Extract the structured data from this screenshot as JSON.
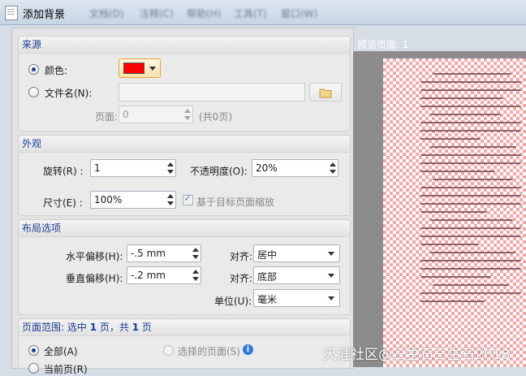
{
  "window": {
    "title": "添加背景",
    "bg_menus": [
      "文档(D)",
      "注释(C)",
      "帮助(H)",
      "工具(T)",
      "窗口(W)"
    ]
  },
  "source": {
    "header": "来源",
    "color_label": "颜色:",
    "color_value": "#ff0000",
    "file_label": "文件名(N):",
    "file_value": "",
    "page_label": "页面:",
    "page_value": "0",
    "page_total": "(共0页)"
  },
  "appearance": {
    "header": "外观",
    "rotation_label": "旋转(R) :",
    "rotation_value": "1",
    "opacity_label": "不透明度(O):",
    "opacity_value": "20%",
    "size_label": "尺寸(E) :",
    "size_value": "100%",
    "scale_label": "基于目标页面缩放"
  },
  "layout": {
    "header": "布局选项",
    "h_offset_label": "水平偏移(H):",
    "h_offset_value": "-.5 mm",
    "v_offset_label": "垂直偏移(H):",
    "v_offset_value": "-.2 mm",
    "align1_label": "对齐:",
    "align1_value": "居中",
    "align2_label": "对齐:",
    "align2_value": "底部",
    "unit_label": "单位(U):",
    "unit_value": "毫米"
  },
  "page_range": {
    "header_prefix": "页面范围: 选中",
    "selected": "1",
    "mid": "页，共",
    "total": "1",
    "suffix": "页",
    "all_label": "全部(A)",
    "selected_pages_label": "选择的页面(S)",
    "info_glyph": "i",
    "partial_label": "当前页(R)"
  },
  "preview": {
    "label": "预览页面: 1"
  },
  "watermark": "天涯社区@三生石三生石2018"
}
